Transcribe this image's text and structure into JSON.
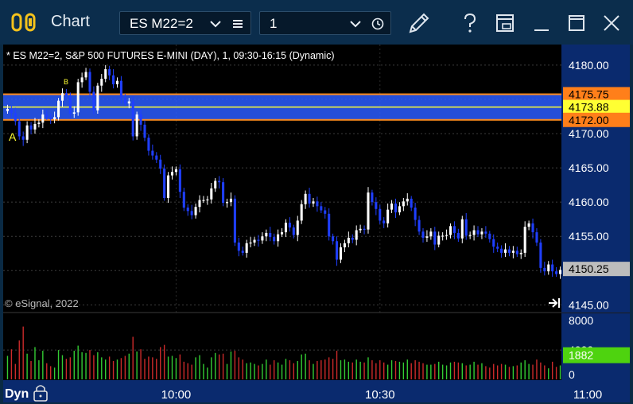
{
  "window": {
    "title": "Chart",
    "symbol_value": "ES M22=2",
    "interval_value": "1"
  },
  "chart_header": "* ES M22=2, S&P 500 FUTURES E-MINI (DAY), 1, 09:30-16:15 (Dynamic)",
  "copyright": "© eSignal, 2022",
  "scale_mode": "Dyn",
  "marks": {
    "a": "A",
    "b": "B"
  },
  "colors": {
    "bg": "#000000",
    "titlebar": "#0b2d4c",
    "axis_bg": "#0a2a6e",
    "up": "#ffffff",
    "down": "#1f3fff",
    "zone_fill": "#2a5cff",
    "zone_border": "#ff8c1a",
    "mid_line": "#ffff33",
    "vol_up": "#33cc33",
    "vol_down": "#cc2a2a"
  },
  "chart_data": {
    "type": "candlestick",
    "price": {
      "ylim": [
        4144,
        4183
      ],
      "ticks": [
        4180,
        4175,
        4170,
        4165,
        4160,
        4155,
        4150,
        4145
      ],
      "tick_labels": [
        "4180.00",
        "4175.00",
        "4170.00",
        "4165.00",
        "4160.00",
        "4155.00",
        "4150.00",
        "4145.00"
      ],
      "levels": [
        {
          "value": 4175.75,
          "label": "4175.75",
          "bg": "#ff7f1a",
          "fg": "#000000"
        },
        {
          "value": 4173.88,
          "label": "4173.88",
          "bg": "#ffff33",
          "fg": "#000000"
        },
        {
          "value": 4172.0,
          "label": "4172.00",
          "bg": "#ff7f1a",
          "fg": "#000000"
        },
        {
          "value": 4150.25,
          "label": "4150.25",
          "bg": "#bdbdbd",
          "fg": "#000000"
        }
      ],
      "zone": {
        "top": 4175.75,
        "bottom": 4172.0,
        "mid": 4173.88
      },
      "close": [
        4173.6,
        4173.0,
        4171.8,
        4169.6,
        4169.1,
        4171.2,
        4170.6,
        4171.4,
        4171.6,
        4172.8,
        4172.4,
        4172.1,
        4172.4,
        4174.8,
        4175.9,
        4175.5,
        4172.9,
        4173.1,
        4177.5,
        4178.2,
        4179.0,
        4176.1,
        4173.4,
        4177.0,
        4178.0,
        4179.4,
        4178.5,
        4177.2,
        4177.7,
        4175.2,
        4174.4,
        4174.7,
        4169.6,
        4172.8,
        4171.3,
        4169.4,
        4167.5,
        4166.8,
        4166.2,
        4164.9,
        4160.6,
        4163.9,
        4164.4,
        4164.8,
        4161.5,
        4159.2,
        4158.7,
        4158.1,
        4159.3,
        4160.3,
        4160.3,
        4160.4,
        4162.0,
        4163.1,
        4162.9,
        4159.9,
        4160.0,
        4160.5,
        4154.1,
        4152.9,
        4152.6,
        4154.0,
        4154.1,
        4154.5,
        4154.4,
        4155.0,
        4155.5,
        4154.9,
        4154.3,
        4155.3,
        4155.6,
        4157.0,
        4156.3,
        4155.2,
        4157.3,
        4159.7,
        4161.2,
        4159.8,
        4160.1,
        4159.4,
        4158.8,
        4158.3,
        4155.0,
        4154.3,
        4151.6,
        4153.4,
        4154.0,
        4154.8,
        4154.5,
        4155.9,
        4156.1,
        4156.0,
        4161.4,
        4160.0,
        4159.0,
        4157.3,
        4156.9,
        4158.9,
        4159.8,
        4158.5,
        4159.4,
        4160.1,
        4160.5,
        4159.2,
        4157.4,
        4155.7,
        4154.8,
        4155.0,
        4155.7,
        4153.8,
        4155.1,
        4155.1,
        4155.2,
        4156.5,
        4155.5,
        4154.7,
        4157.5,
        4155.1,
        4155.2,
        4155.9,
        4155.3,
        4155.7,
        4155.4,
        4154.6,
        4153.5,
        4153.2,
        4152.6,
        4153.1,
        4152.6,
        4152.9,
        4152.4,
        4152.6,
        4156.4,
        4156.9,
        4155.6,
        4154.1,
        4150.4,
        4149.9,
        4150.9,
        4149.9,
        4149.5,
        4150.1
      ],
      "wick_pad": [
        0.6,
        0.5,
        0.8,
        0.4,
        0.7,
        0.6,
        0.5,
        0.9,
        0.5,
        0.7
      ]
    },
    "volume": {
      "ylim": [
        0,
        9000
      ],
      "ticks": [
        8000,
        4000,
        0
      ],
      "tick_labels": [
        "8000",
        "4000",
        "0"
      ],
      "last": {
        "value": 1882,
        "label": "1882",
        "bg": "#4ed30f",
        "fg": "#ffffff"
      },
      "values": [
        3200,
        4100,
        2100,
        5300,
        7200,
        3500,
        2500,
        4400,
        2600,
        3900,
        2200,
        1800,
        1600,
        4000,
        3300,
        2800,
        3000,
        3900,
        4600,
        3700,
        3600,
        4000,
        3300,
        3700,
        3000,
        2700,
        3100,
        2500,
        2700,
        2900,
        3200,
        3500,
        5800,
        3800,
        4100,
        2800,
        3100,
        3000,
        2800,
        4400,
        4700,
        3100,
        3200,
        2900,
        3400,
        2400,
        2200,
        2000,
        3000,
        3300,
        2100,
        1600,
        3000,
        3600,
        3400,
        3500,
        2100,
        3800,
        3900,
        3000,
        2700,
        2200,
        2300,
        2100,
        1900,
        2100,
        2700,
        2000,
        2600,
        2300,
        2000,
        2800,
        2600,
        2200,
        2500,
        3400,
        3500,
        2600,
        2100,
        2500,
        2600,
        2700,
        3000,
        2800,
        3900,
        2600,
        2700,
        2400,
        2300,
        2700,
        2400,
        2300,
        3000,
        2600,
        2200,
        2600,
        2300,
        2000,
        2600,
        2500,
        2400,
        2300,
        2700,
        2200,
        2600,
        2400,
        2200,
        2000,
        2000,
        2100,
        2400,
        2000,
        1900,
        2300,
        2400,
        2300,
        2200,
        1900,
        2000,
        2400,
        2000,
        2200,
        1800,
        1600,
        2100,
        1900,
        2100,
        2000,
        1700,
        1800,
        1900,
        2300,
        2600,
        2100,
        2000,
        2700,
        2300,
        1900,
        1500,
        2400,
        1700,
        1900
      ]
    },
    "x_axis": {
      "labels": [
        {
          "text": "10:00",
          "bar": 43
        },
        {
          "text": "10:30",
          "bar": 95
        },
        {
          "text": "11:00",
          "bar": 148
        }
      ]
    }
  }
}
